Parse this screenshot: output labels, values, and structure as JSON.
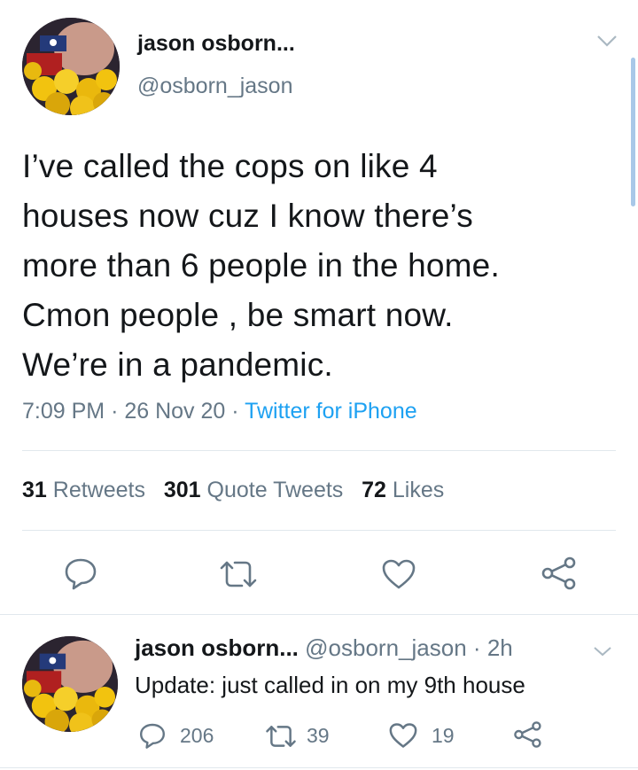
{
  "main_tweet": {
    "author_name": "jason osborn...",
    "handle": "@osborn_jason",
    "lines": [
      "I’ve called the cops on like 4",
      "houses now cuz I know there’s",
      "more than 6 people in the home.",
      "Cmon people , be smart now.",
      "We’re in a pandemic."
    ],
    "time": "7:09 PM",
    "date": "26 Nov 20",
    "source": "Twitter for iPhone",
    "sep": "·",
    "stats": {
      "retweets_count": "31",
      "retweets_label": "Retweets",
      "quotes_count": "301",
      "quotes_label": "Quote Tweets",
      "likes_count": "72",
      "likes_label": "Likes"
    }
  },
  "reply_tweet": {
    "author_name": "jason osborn...",
    "handle": "@osborn_jason",
    "time_ago": "2h",
    "sep": "·",
    "text": "Update: just called in on my 9th house",
    "reply_count": "206",
    "retweet_count": "39",
    "like_count": "19"
  },
  "icons": [
    "chevron-down-icon",
    "reply-icon",
    "retweet-icon",
    "like-icon",
    "share-icon"
  ],
  "colors": {
    "text": "#14171a",
    "secondary": "#657786",
    "link": "#1da1f2",
    "divider": "#e1e8ed"
  }
}
